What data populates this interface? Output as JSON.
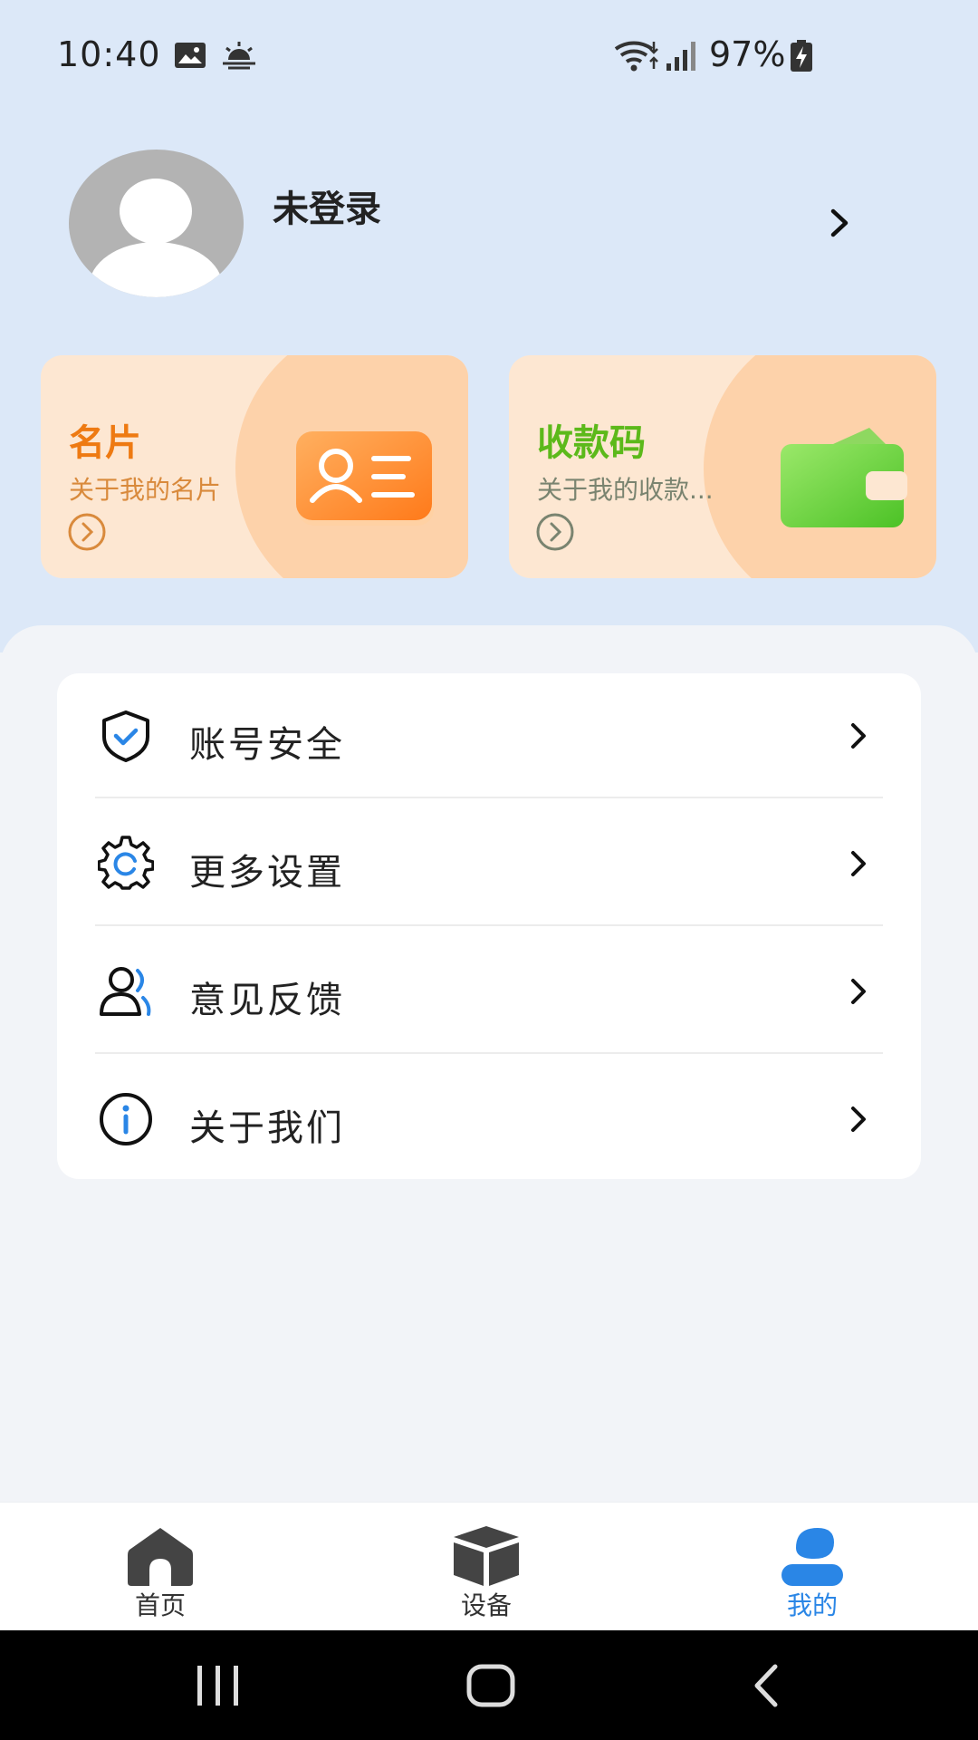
{
  "status_bar": {
    "time": "10:40",
    "battery": "97%",
    "icons": [
      "gallery-icon",
      "weather-icon",
      "wifi-icon",
      "signal-icon",
      "battery-charging-icon"
    ]
  },
  "profile": {
    "username": "未登录",
    "avatar_icon": "default-avatar-icon",
    "arrow_icon": "chevron-right-icon"
  },
  "cards": {
    "business_card": {
      "title": "名片",
      "subtitle": "关于我的名片",
      "icon": "id-card-icon",
      "title_color": "#ee7a12",
      "subtitle_color": "#d98a3c"
    },
    "payment_code": {
      "title": "收款码",
      "subtitle": "关于我的收款...",
      "icon": "wallet-icon",
      "title_color": "#5cb91a",
      "subtitle_color": "#7a8470"
    }
  },
  "menu": {
    "items": [
      {
        "label": "账号安全",
        "icon": "shield-check-icon"
      },
      {
        "label": "更多设置",
        "icon": "gear-icon"
      },
      {
        "label": "意见反馈",
        "icon": "users-feedback-icon"
      },
      {
        "label": "关于我们",
        "icon": "info-icon"
      }
    ]
  },
  "bottom_nav": {
    "items": [
      {
        "label": "首页",
        "icon": "home-icon",
        "active": false
      },
      {
        "label": "设备",
        "icon": "box-icon",
        "active": false
      },
      {
        "label": "我的",
        "icon": "user-icon",
        "active": true
      }
    ],
    "active_color": "#2a86e6"
  },
  "system_nav": {
    "icons": [
      "recent-apps-icon",
      "home-button-icon",
      "back-icon"
    ]
  }
}
